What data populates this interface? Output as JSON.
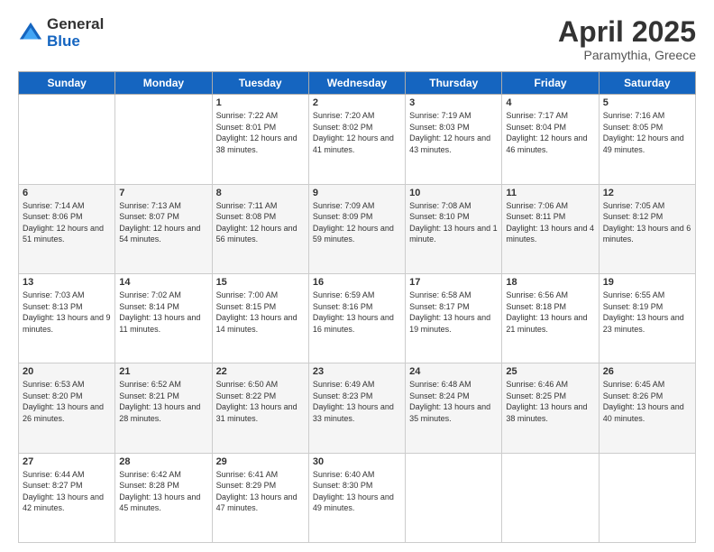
{
  "logo": {
    "general": "General",
    "blue": "Blue"
  },
  "title": "April 2025",
  "location": "Paramythia, Greece",
  "days_header": [
    "Sunday",
    "Monday",
    "Tuesday",
    "Wednesday",
    "Thursday",
    "Friday",
    "Saturday"
  ],
  "weeks": [
    [
      {
        "day": "",
        "sunrise": "",
        "sunset": "",
        "daylight": ""
      },
      {
        "day": "",
        "sunrise": "",
        "sunset": "",
        "daylight": ""
      },
      {
        "day": "1",
        "sunrise": "Sunrise: 7:22 AM",
        "sunset": "Sunset: 8:01 PM",
        "daylight": "Daylight: 12 hours and 38 minutes."
      },
      {
        "day": "2",
        "sunrise": "Sunrise: 7:20 AM",
        "sunset": "Sunset: 8:02 PM",
        "daylight": "Daylight: 12 hours and 41 minutes."
      },
      {
        "day": "3",
        "sunrise": "Sunrise: 7:19 AM",
        "sunset": "Sunset: 8:03 PM",
        "daylight": "Daylight: 12 hours and 43 minutes."
      },
      {
        "day": "4",
        "sunrise": "Sunrise: 7:17 AM",
        "sunset": "Sunset: 8:04 PM",
        "daylight": "Daylight: 12 hours and 46 minutes."
      },
      {
        "day": "5",
        "sunrise": "Sunrise: 7:16 AM",
        "sunset": "Sunset: 8:05 PM",
        "daylight": "Daylight: 12 hours and 49 minutes."
      }
    ],
    [
      {
        "day": "6",
        "sunrise": "Sunrise: 7:14 AM",
        "sunset": "Sunset: 8:06 PM",
        "daylight": "Daylight: 12 hours and 51 minutes."
      },
      {
        "day": "7",
        "sunrise": "Sunrise: 7:13 AM",
        "sunset": "Sunset: 8:07 PM",
        "daylight": "Daylight: 12 hours and 54 minutes."
      },
      {
        "day": "8",
        "sunrise": "Sunrise: 7:11 AM",
        "sunset": "Sunset: 8:08 PM",
        "daylight": "Daylight: 12 hours and 56 minutes."
      },
      {
        "day": "9",
        "sunrise": "Sunrise: 7:09 AM",
        "sunset": "Sunset: 8:09 PM",
        "daylight": "Daylight: 12 hours and 59 minutes."
      },
      {
        "day": "10",
        "sunrise": "Sunrise: 7:08 AM",
        "sunset": "Sunset: 8:10 PM",
        "daylight": "Daylight: 13 hours and 1 minute."
      },
      {
        "day": "11",
        "sunrise": "Sunrise: 7:06 AM",
        "sunset": "Sunset: 8:11 PM",
        "daylight": "Daylight: 13 hours and 4 minutes."
      },
      {
        "day": "12",
        "sunrise": "Sunrise: 7:05 AM",
        "sunset": "Sunset: 8:12 PM",
        "daylight": "Daylight: 13 hours and 6 minutes."
      }
    ],
    [
      {
        "day": "13",
        "sunrise": "Sunrise: 7:03 AM",
        "sunset": "Sunset: 8:13 PM",
        "daylight": "Daylight: 13 hours and 9 minutes."
      },
      {
        "day": "14",
        "sunrise": "Sunrise: 7:02 AM",
        "sunset": "Sunset: 8:14 PM",
        "daylight": "Daylight: 13 hours and 11 minutes."
      },
      {
        "day": "15",
        "sunrise": "Sunrise: 7:00 AM",
        "sunset": "Sunset: 8:15 PM",
        "daylight": "Daylight: 13 hours and 14 minutes."
      },
      {
        "day": "16",
        "sunrise": "Sunrise: 6:59 AM",
        "sunset": "Sunset: 8:16 PM",
        "daylight": "Daylight: 13 hours and 16 minutes."
      },
      {
        "day": "17",
        "sunrise": "Sunrise: 6:58 AM",
        "sunset": "Sunset: 8:17 PM",
        "daylight": "Daylight: 13 hours and 19 minutes."
      },
      {
        "day": "18",
        "sunrise": "Sunrise: 6:56 AM",
        "sunset": "Sunset: 8:18 PM",
        "daylight": "Daylight: 13 hours and 21 minutes."
      },
      {
        "day": "19",
        "sunrise": "Sunrise: 6:55 AM",
        "sunset": "Sunset: 8:19 PM",
        "daylight": "Daylight: 13 hours and 23 minutes."
      }
    ],
    [
      {
        "day": "20",
        "sunrise": "Sunrise: 6:53 AM",
        "sunset": "Sunset: 8:20 PM",
        "daylight": "Daylight: 13 hours and 26 minutes."
      },
      {
        "day": "21",
        "sunrise": "Sunrise: 6:52 AM",
        "sunset": "Sunset: 8:21 PM",
        "daylight": "Daylight: 13 hours and 28 minutes."
      },
      {
        "day": "22",
        "sunrise": "Sunrise: 6:50 AM",
        "sunset": "Sunset: 8:22 PM",
        "daylight": "Daylight: 13 hours and 31 minutes."
      },
      {
        "day": "23",
        "sunrise": "Sunrise: 6:49 AM",
        "sunset": "Sunset: 8:23 PM",
        "daylight": "Daylight: 13 hours and 33 minutes."
      },
      {
        "day": "24",
        "sunrise": "Sunrise: 6:48 AM",
        "sunset": "Sunset: 8:24 PM",
        "daylight": "Daylight: 13 hours and 35 minutes."
      },
      {
        "day": "25",
        "sunrise": "Sunrise: 6:46 AM",
        "sunset": "Sunset: 8:25 PM",
        "daylight": "Daylight: 13 hours and 38 minutes."
      },
      {
        "day": "26",
        "sunrise": "Sunrise: 6:45 AM",
        "sunset": "Sunset: 8:26 PM",
        "daylight": "Daylight: 13 hours and 40 minutes."
      }
    ],
    [
      {
        "day": "27",
        "sunrise": "Sunrise: 6:44 AM",
        "sunset": "Sunset: 8:27 PM",
        "daylight": "Daylight: 13 hours and 42 minutes."
      },
      {
        "day": "28",
        "sunrise": "Sunrise: 6:42 AM",
        "sunset": "Sunset: 8:28 PM",
        "daylight": "Daylight: 13 hours and 45 minutes."
      },
      {
        "day": "29",
        "sunrise": "Sunrise: 6:41 AM",
        "sunset": "Sunset: 8:29 PM",
        "daylight": "Daylight: 13 hours and 47 minutes."
      },
      {
        "day": "30",
        "sunrise": "Sunrise: 6:40 AM",
        "sunset": "Sunset: 8:30 PM",
        "daylight": "Daylight: 13 hours and 49 minutes."
      },
      {
        "day": "",
        "sunrise": "",
        "sunset": "",
        "daylight": ""
      },
      {
        "day": "",
        "sunrise": "",
        "sunset": "",
        "daylight": ""
      },
      {
        "day": "",
        "sunrise": "",
        "sunset": "",
        "daylight": ""
      }
    ]
  ]
}
